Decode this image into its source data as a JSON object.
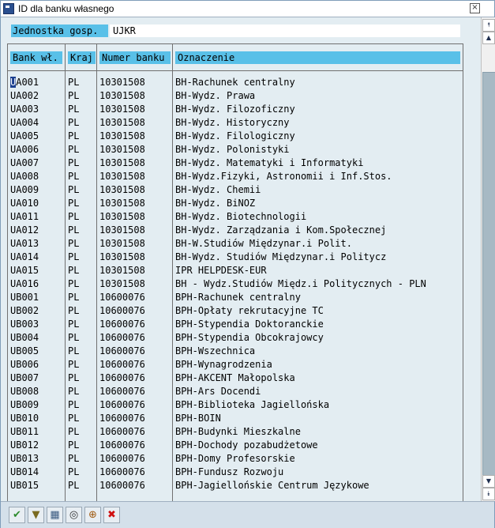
{
  "window": {
    "title": "ID dla banku własnego",
    "close_glyph": "×"
  },
  "unit": {
    "label": "Jednostka gosp.",
    "value": "UJKR"
  },
  "table": {
    "columns": [
      "Bank wł.",
      "Kraj",
      "Numer banku",
      "Oznaczenie"
    ],
    "rows": [
      [
        "UA001",
        "PL",
        "10301508",
        "BH-Rachunek centralny"
      ],
      [
        "UA002",
        "PL",
        "10301508",
        "BH-Wydz. Prawa"
      ],
      [
        "UA003",
        "PL",
        "10301508",
        "BH-Wydz. Filozoficzny"
      ],
      [
        "UA004",
        "PL",
        "10301508",
        "BH-Wydz. Historyczny"
      ],
      [
        "UA005",
        "PL",
        "10301508",
        "BH-Wydz. Filologiczny"
      ],
      [
        "UA006",
        "PL",
        "10301508",
        "BH-Wydz. Polonistyki"
      ],
      [
        "UA007",
        "PL",
        "10301508",
        "BH-Wydz. Matematyki  i Informatyki"
      ],
      [
        "UA008",
        "PL",
        "10301508",
        "BH-Wydz.Fizyki, Astronomii i Inf.Stos."
      ],
      [
        "UA009",
        "PL",
        "10301508",
        "BH-Wydz. Chemii"
      ],
      [
        "UA010",
        "PL",
        "10301508",
        "BH-Wydz. BiNOZ"
      ],
      [
        "UA011",
        "PL",
        "10301508",
        "BH-Wydz. Biotechnologii"
      ],
      [
        "UA012",
        "PL",
        "10301508",
        "BH-Wydz. Zarządzania i Kom.Społecznej"
      ],
      [
        "UA013",
        "PL",
        "10301508",
        "BH-W.Studiów Międzynar.i Polit."
      ],
      [
        "UA014",
        "PL",
        "10301508",
        "BH-Wydz. Studiów Międzynar.i Politycz"
      ],
      [
        "UA015",
        "PL",
        "10301508",
        "IPR HELPDESK-EUR"
      ],
      [
        "UA016",
        "PL",
        "10301508",
        "BH - Wydz.Studiów Międz.i Politycznych - PLN"
      ],
      [
        "UB001",
        "PL",
        "10600076",
        "BPH-Rachunek centralny"
      ],
      [
        "UB002",
        "PL",
        "10600076",
        "BPH-Opłaty rekrutacyjne TC"
      ],
      [
        "UB003",
        "PL",
        "10600076",
        "BPH-Stypendia Doktoranckie"
      ],
      [
        "UB004",
        "PL",
        "10600076",
        "BPH-Stypendia Obcokrajowcy"
      ],
      [
        "UB005",
        "PL",
        "10600076",
        "BPH-Wszechnica"
      ],
      [
        "UB006",
        "PL",
        "10600076",
        "BPH-Wynagrodzenia"
      ],
      [
        "UB007",
        "PL",
        "10600076",
        "BPH-AKCENT Małopolska"
      ],
      [
        "UB008",
        "PL",
        "10600076",
        "BPH-Ars Docendi"
      ],
      [
        "UB009",
        "PL",
        "10600076",
        "BPH-Biblioteka Jagiellońska"
      ],
      [
        "UB010",
        "PL",
        "10600076",
        "BPH-BOIN"
      ],
      [
        "UB011",
        "PL",
        "10600076",
        "BPH-Budynki Mieszkalne"
      ],
      [
        "UB012",
        "PL",
        "10600076",
        "BPH-Dochody pozabudżetowe"
      ],
      [
        "UB013",
        "PL",
        "10600076",
        "BPH-Domy Profesorskie"
      ],
      [
        "UB014",
        "PL",
        "10600076",
        "BPH-Fundusz Rozwoju"
      ],
      [
        "UB015",
        "PL",
        "10600076",
        "BPH-Jagiellońskie Centrum Językowe"
      ]
    ]
  },
  "scrollbar": {
    "up_glyph": "▲",
    "down_glyph": "▼",
    "top_glyph": "⯭",
    "bottom_glyph": "⯯"
  },
  "toolbar": {
    "buttons": [
      {
        "name": "confirm-button",
        "icon": "checkmark-icon",
        "glyph": "✔",
        "color": "#2e8b2e"
      },
      {
        "name": "filter-button",
        "icon": "filter-icon",
        "glyph": "▼",
        "color": "#7a6a20"
      },
      {
        "name": "select-button",
        "icon": "table-select-icon",
        "glyph": "▦",
        "color": "#3a5a80"
      },
      {
        "name": "find-button",
        "icon": "binoculars-icon",
        "glyph": "◎",
        "color": "#333333"
      },
      {
        "name": "find-next-button",
        "icon": "find-next-icon",
        "glyph": "⊕",
        "color": "#a05a10"
      },
      {
        "name": "cancel-button",
        "icon": "cancel-icon",
        "glyph": "✖",
        "color": "#d01010"
      }
    ]
  }
}
